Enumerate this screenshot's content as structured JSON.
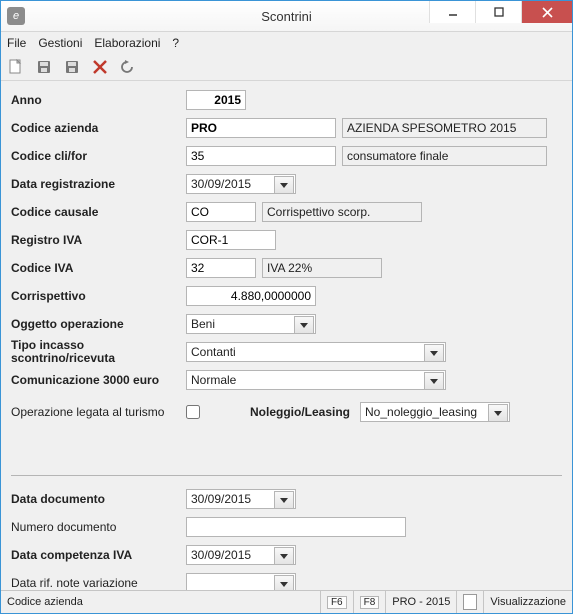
{
  "window": {
    "title": "Scontrini"
  },
  "menu": {
    "file": "File",
    "gestioni": "Gestioni",
    "elaborazioni": "Elaborazioni",
    "help": "?"
  },
  "form": {
    "anno": {
      "label": "Anno",
      "value": "2015"
    },
    "codice_azienda": {
      "label": "Codice azienda",
      "value": "PRO",
      "desc": "AZIENDA SPESOMETRO 2015"
    },
    "codice_clifor": {
      "label": "Codice cli/for",
      "value": "35",
      "desc": "consumatore finale"
    },
    "data_registrazione": {
      "label": "Data registrazione",
      "value": "30/09/2015"
    },
    "codice_causale": {
      "label": "Codice causale",
      "value": "CO",
      "desc": "Corrispettivo scorp."
    },
    "registro_iva": {
      "label": "Registro IVA",
      "value": "COR-1"
    },
    "codice_iva": {
      "label": "Codice IVA",
      "value": "32",
      "desc": "IVA 22%"
    },
    "corrispettivo": {
      "label": "Corrispettivo",
      "value": "4.880,0000000"
    },
    "oggetto_operazione": {
      "label": "Oggetto operazione",
      "value": "Beni"
    },
    "tipo_incasso": {
      "label": "Tipo incasso scontrino/ricevuta",
      "value": "Contanti"
    },
    "comunicazione_3000": {
      "label": "Comunicazione 3000 euro",
      "value": "Normale"
    },
    "operazione_turismo": {
      "label": "Operazione legata al turismo"
    },
    "noleggio": {
      "label": "Noleggio/Leasing",
      "value": "No_noleggio_leasing"
    },
    "data_documento": {
      "label": "Data documento",
      "value": "30/09/2015"
    },
    "numero_documento": {
      "label": "Numero documento",
      "value": ""
    },
    "data_competenza_iva": {
      "label": "Data competenza IVA",
      "value": "30/09/2015"
    },
    "data_rif_note": {
      "label": "Data rif. note variazione",
      "value": ""
    }
  },
  "status": {
    "left": "Codice azienda",
    "f6": "F6",
    "f8": "F8",
    "center": "PRO - 2015",
    "mode": "Visualizzazione"
  }
}
